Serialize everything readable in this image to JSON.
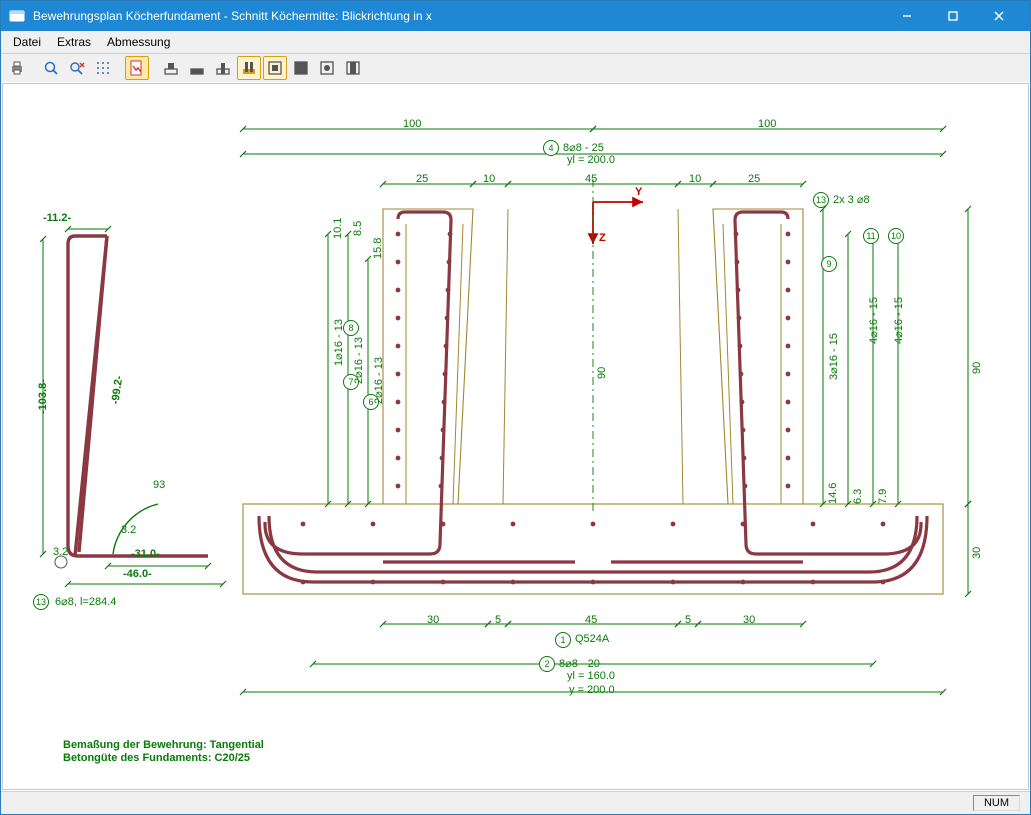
{
  "window": {
    "title": "Bewehrungsplan Köcherfundament - Schnitt Köchermitte: Blickrichtung in x"
  },
  "menu": {
    "file": "Datei",
    "extras": "Extras",
    "dim": "Abmessung"
  },
  "status": {
    "num": "NUM"
  },
  "detail": {
    "pos": "13",
    "spec": "6⌀8, l=284.4",
    "d_top": "-11.2-",
    "d_left": "-103.8-",
    "d_diag": "-99.2-",
    "ang": "93",
    "r1": "3.2",
    "r2": "3.2",
    "d_bott": "-31.0-",
    "d_bott2": "-46.0-"
  },
  "top": {
    "half": "100",
    "seg_25a": "25",
    "seg_10a": "10",
    "seg_45": "45",
    "seg_10b": "10",
    "seg_25b": "25",
    "pos4": "4",
    "pos4_spec": "8⌀8 - 25",
    "pos4_yl": "yl = 200.0"
  },
  "right": {
    "pos13": "13",
    "pos13_spec": "2x 3 ⌀8",
    "pos11": "11",
    "pos10": "10",
    "pos9": "9",
    "h90": "90",
    "r9": "3⌀16 - 15",
    "r11": "4⌀16 - 15",
    "r10": "4⌀16 - 15",
    "h146": "14.6",
    "h63": "6.3",
    "h79": "7.9",
    "h30": "30"
  },
  "left": {
    "pos8": "8",
    "pos7": "7",
    "pos6": "6",
    "l8": "1⌀16 - 13",
    "l7": "2⌀16 - 13",
    "l6": "2⌀16 - 13",
    "h101": "10.1",
    "h85": "8.5",
    "h158": "15.8",
    "mid90": "90"
  },
  "bottom": {
    "seg_30a": "30",
    "seg_5a": "5",
    "seg_45": "45",
    "seg_5b": "5",
    "seg_30b": "30",
    "pos1": "1",
    "pos1_spec": "Q524A",
    "pos2": "2",
    "pos2_spec": "8⌀8 - 20",
    "pos2_yl": "yl = 160.0",
    "pos2_y": "y = 200.0"
  },
  "notes": {
    "a": "Bemaßung der Bewehrung: Tangential",
    "b": "Betongüte des Fundaments: C20/25"
  },
  "axes": {
    "y": "Y",
    "z": "Z"
  }
}
